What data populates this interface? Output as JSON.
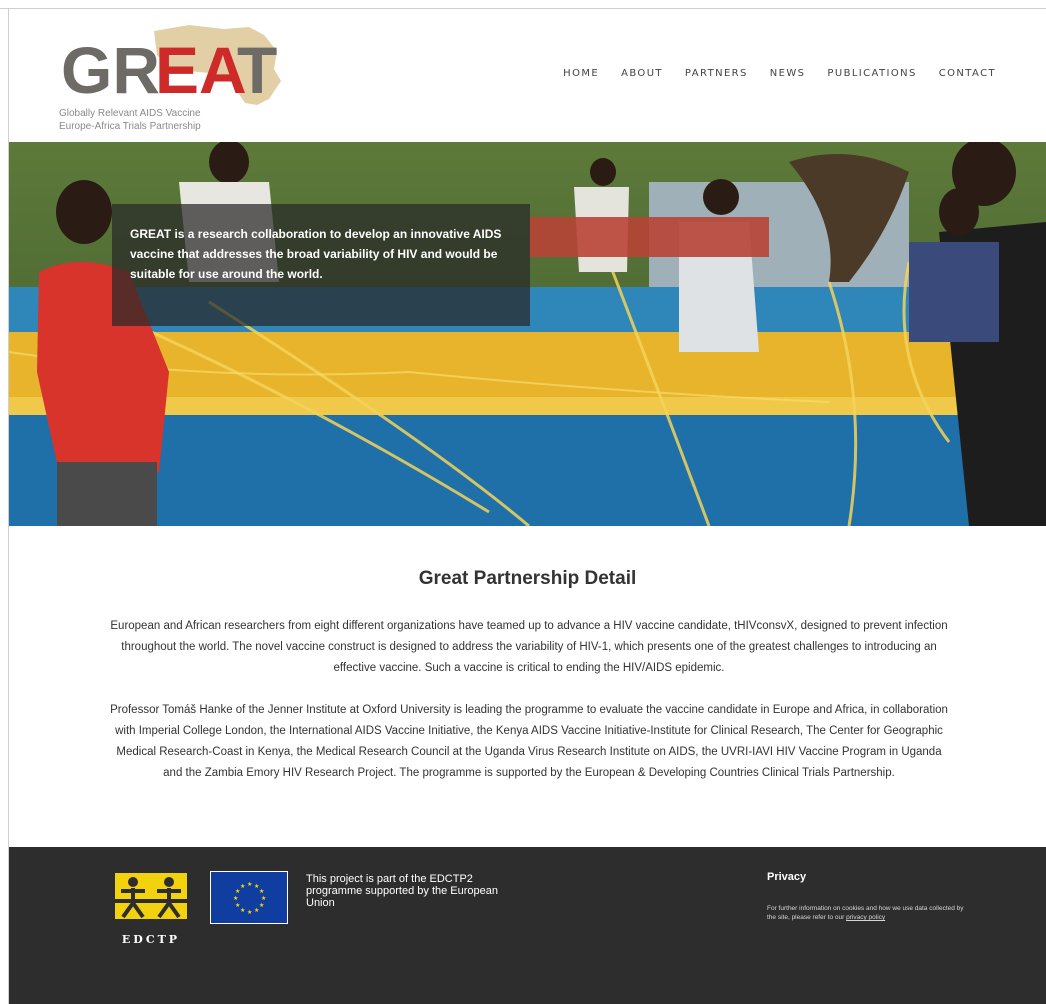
{
  "header": {
    "logo_text": "GREAT",
    "logo_tagline_1": "Globally Relevant AIDS Vaccine",
    "logo_tagline_2": "Europe-Africa Trials Partnership",
    "nav": [
      "HOME",
      "ABOUT",
      "PARTNERS",
      "NEWS",
      "PUBLICATIONS",
      "CONTACT"
    ]
  },
  "hero": {
    "caption": "GREAT is a research collaboration to develop an innovative AIDS vaccine that addresses the broad variability of HIV and would be suitable for use around the world."
  },
  "content": {
    "title": "Great Partnership Detail",
    "paragraph_1": "European and African researchers from eight different organizations have teamed up to advance a HIV vaccine candidate, tHIVconsvX, designed to prevent infection throughout the world. The novel vaccine construct is designed to address the variability of HIV-1, which presents one of the greatest challenges to introducing an effective vaccine. Such a vaccine is critical to ending the HIV/AIDS epidemic.",
    "paragraph_2": "Professor Tomáš Hanke of the Jenner Institute at Oxford University is leading the programme to evaluate the vaccine candidate in Europe and Africa, in collaboration with Imperial College London, the International AIDS Vaccine Initiative, the Kenya AIDS Vaccine Initiative-Institute for Clinical Research, The Center for Geographic Medical Research-Coast in Kenya, the Medical Research Council at the Uganda Virus Research Institute on AIDS, the UVRI-IAVI HIV Vaccine Program in Uganda and the Zambia Emory HIV Research Project. The programme is supported by the European & Developing Countries Clinical Trials Partnership."
  },
  "footer": {
    "edctp_label": "EDCTP",
    "support_text": "This project is part of the EDCTP2 programme supported by the European Union",
    "privacy_title": "Privacy",
    "privacy_text": "For further information on cookies and how we use data collected by the site, please refer to our",
    "privacy_link": "privacy policy"
  },
  "colors": {
    "logo_gray": "#6e6a66",
    "logo_red": "#cf2a2a",
    "africa_tan": "#e2cfa5",
    "footer_bg": "#2d2d2d",
    "eu_blue": "#0f3ea0",
    "eu_gold": "#ffd700",
    "edctp_yellow": "#f2d20f"
  }
}
